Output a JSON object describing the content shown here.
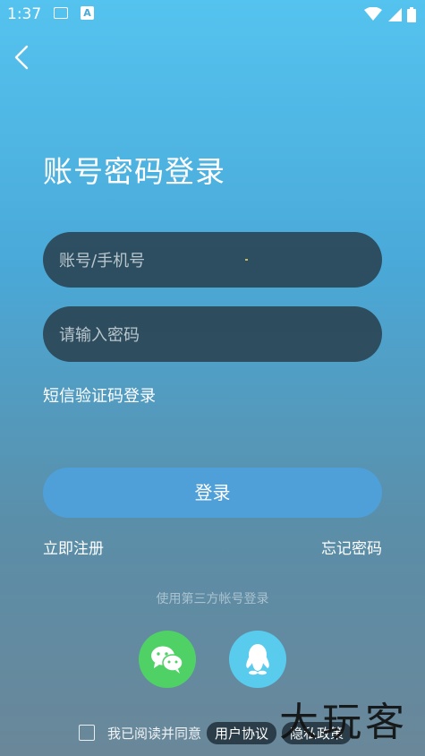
{
  "status_bar": {
    "time": "1:37",
    "a_icon": "A"
  },
  "header": {
    "title": "账号密码登录"
  },
  "form": {
    "account_placeholder": "账号/手机号",
    "password_placeholder": "请输入密码",
    "sms_login": "短信验证码登录",
    "login_button": "登录",
    "register": "立即注册",
    "forgot_password": "忘记密码"
  },
  "third_party": {
    "label": "使用第三方帐号登录",
    "icons": [
      "wechat-icon",
      "qq-icon"
    ]
  },
  "agreement": {
    "text": "我已阅读并同意",
    "user_agreement": "用户协议",
    "privacy_policy": "隐私政策"
  },
  "watermark": "大玩客",
  "colors": {
    "wechat": "#4fd166",
    "qq": "#59ccee",
    "login_button": "#4f9fd8"
  }
}
